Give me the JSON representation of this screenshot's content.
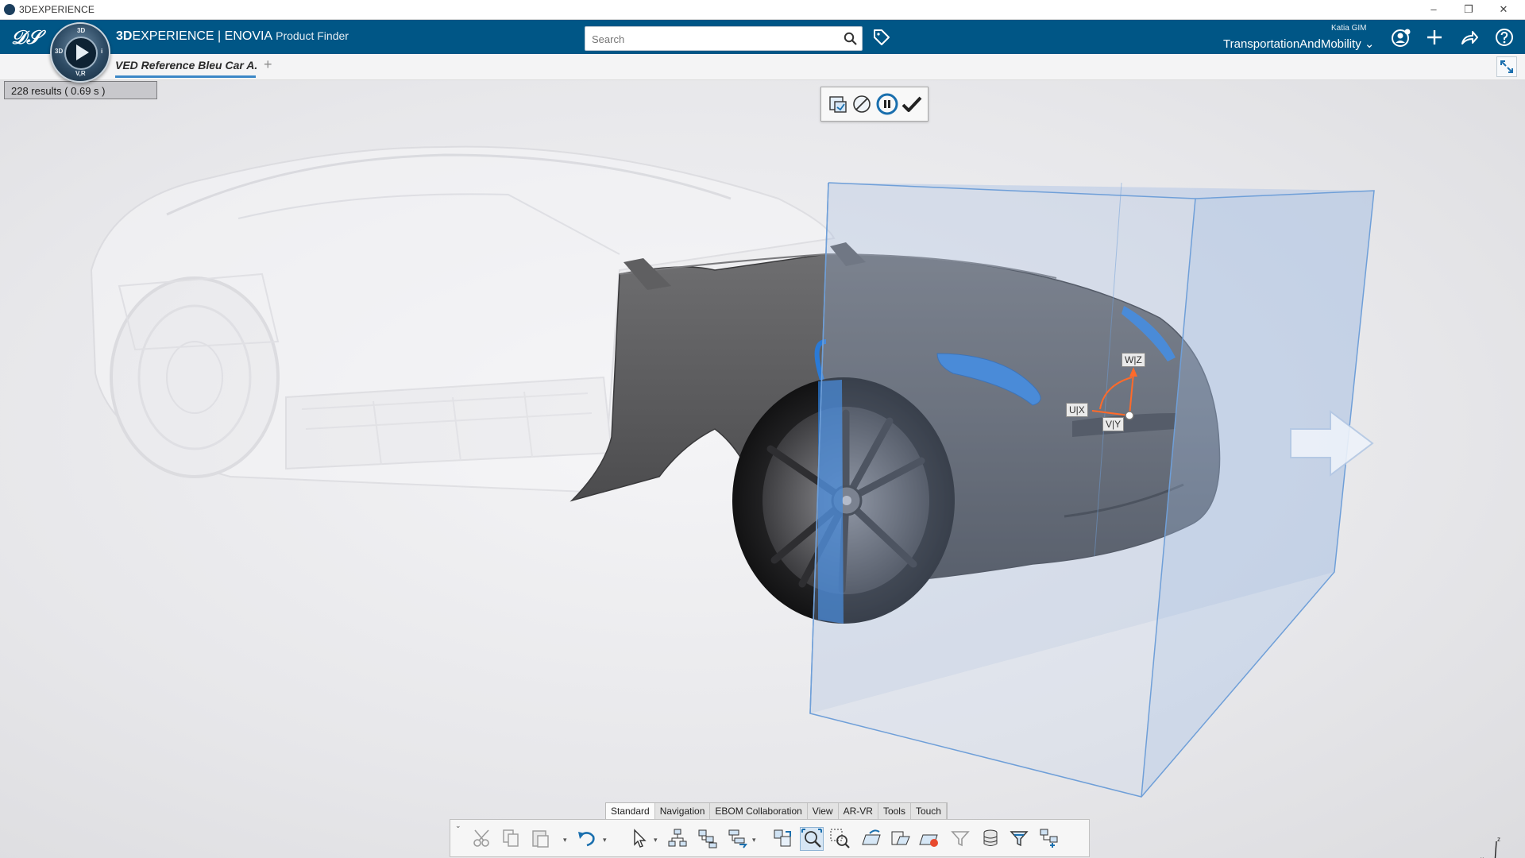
{
  "window": {
    "title": "3DEXPERIENCE",
    "minimize": "–",
    "restore": "❐",
    "close": "✕"
  },
  "header": {
    "brand_prefix": "3D",
    "brand_main": "EXPERIENCE | ENOVIA",
    "app_name": "Product Finder",
    "search_placeholder": "Search",
    "user": "Katia GIM",
    "tenant": "TransportationAndMobility",
    "compass_labels": {
      "top": "3D",
      "left": "3D",
      "right": "i",
      "bottom": "V,R"
    }
  },
  "tab": {
    "label": "VED Reference Bleu Car A.",
    "add": "+"
  },
  "results": {
    "text": "228 results  ( 0.69 s )"
  },
  "robot": {
    "w": "W|Z",
    "u": "U|X",
    "v": "V|Y"
  },
  "section_tabs": [
    "Standard",
    "Navigation",
    "EBOM Collaboration",
    "View",
    "AR-VR",
    "Tools",
    "Touch"
  ],
  "active_section": "Standard",
  "colors": {
    "header": "#005686",
    "accent": "#3c88c7",
    "box": "#6f9fd8",
    "car_body": "#5a5a5c"
  },
  "icons": [
    "scissors-icon",
    "copy-icon",
    "paste-icon",
    "undo-icon",
    "select-icon",
    "tree-icon",
    "tree-expand-icon",
    "tree-filter-icon",
    "reframe-icon",
    "zoom-fit-icon",
    "zoom-area-icon",
    "open-icon",
    "open-with-icon",
    "save-icon",
    "filter-icon",
    "database-icon",
    "funnel-icon",
    "structure-icon"
  ]
}
